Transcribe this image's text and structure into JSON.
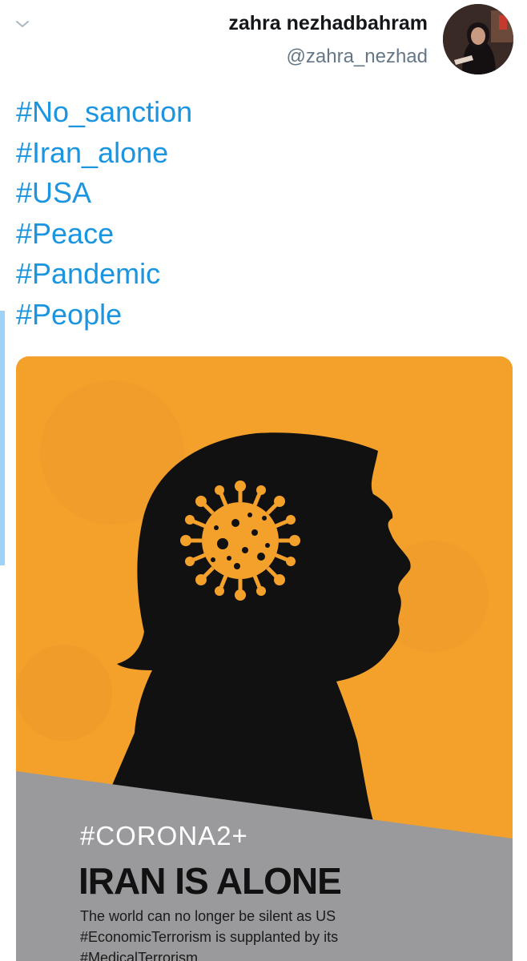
{
  "author": {
    "name": "zahra nezhadbahram",
    "handle": "@zahra_nezhad"
  },
  "tweet": {
    "hashtags": [
      "#No_sanction",
      "#Iran_alone",
      "#USA",
      "#Peace",
      "#Pandemic",
      "#People"
    ]
  },
  "media": {
    "tag": "#CORONA2+",
    "headline": "IRAN IS ALONE",
    "body": "The world can no longer be silent as US #EconomicTerrorism is supplanted by its #MedicalTerrorism"
  },
  "colors": {
    "hashtag": "#1b95e0",
    "handle": "#657786",
    "poster_orange": "#f4a12c",
    "poster_gray": "#9a9a9c",
    "silhouette": "#111111"
  },
  "icons": {
    "menu": "chevron-down-icon"
  }
}
